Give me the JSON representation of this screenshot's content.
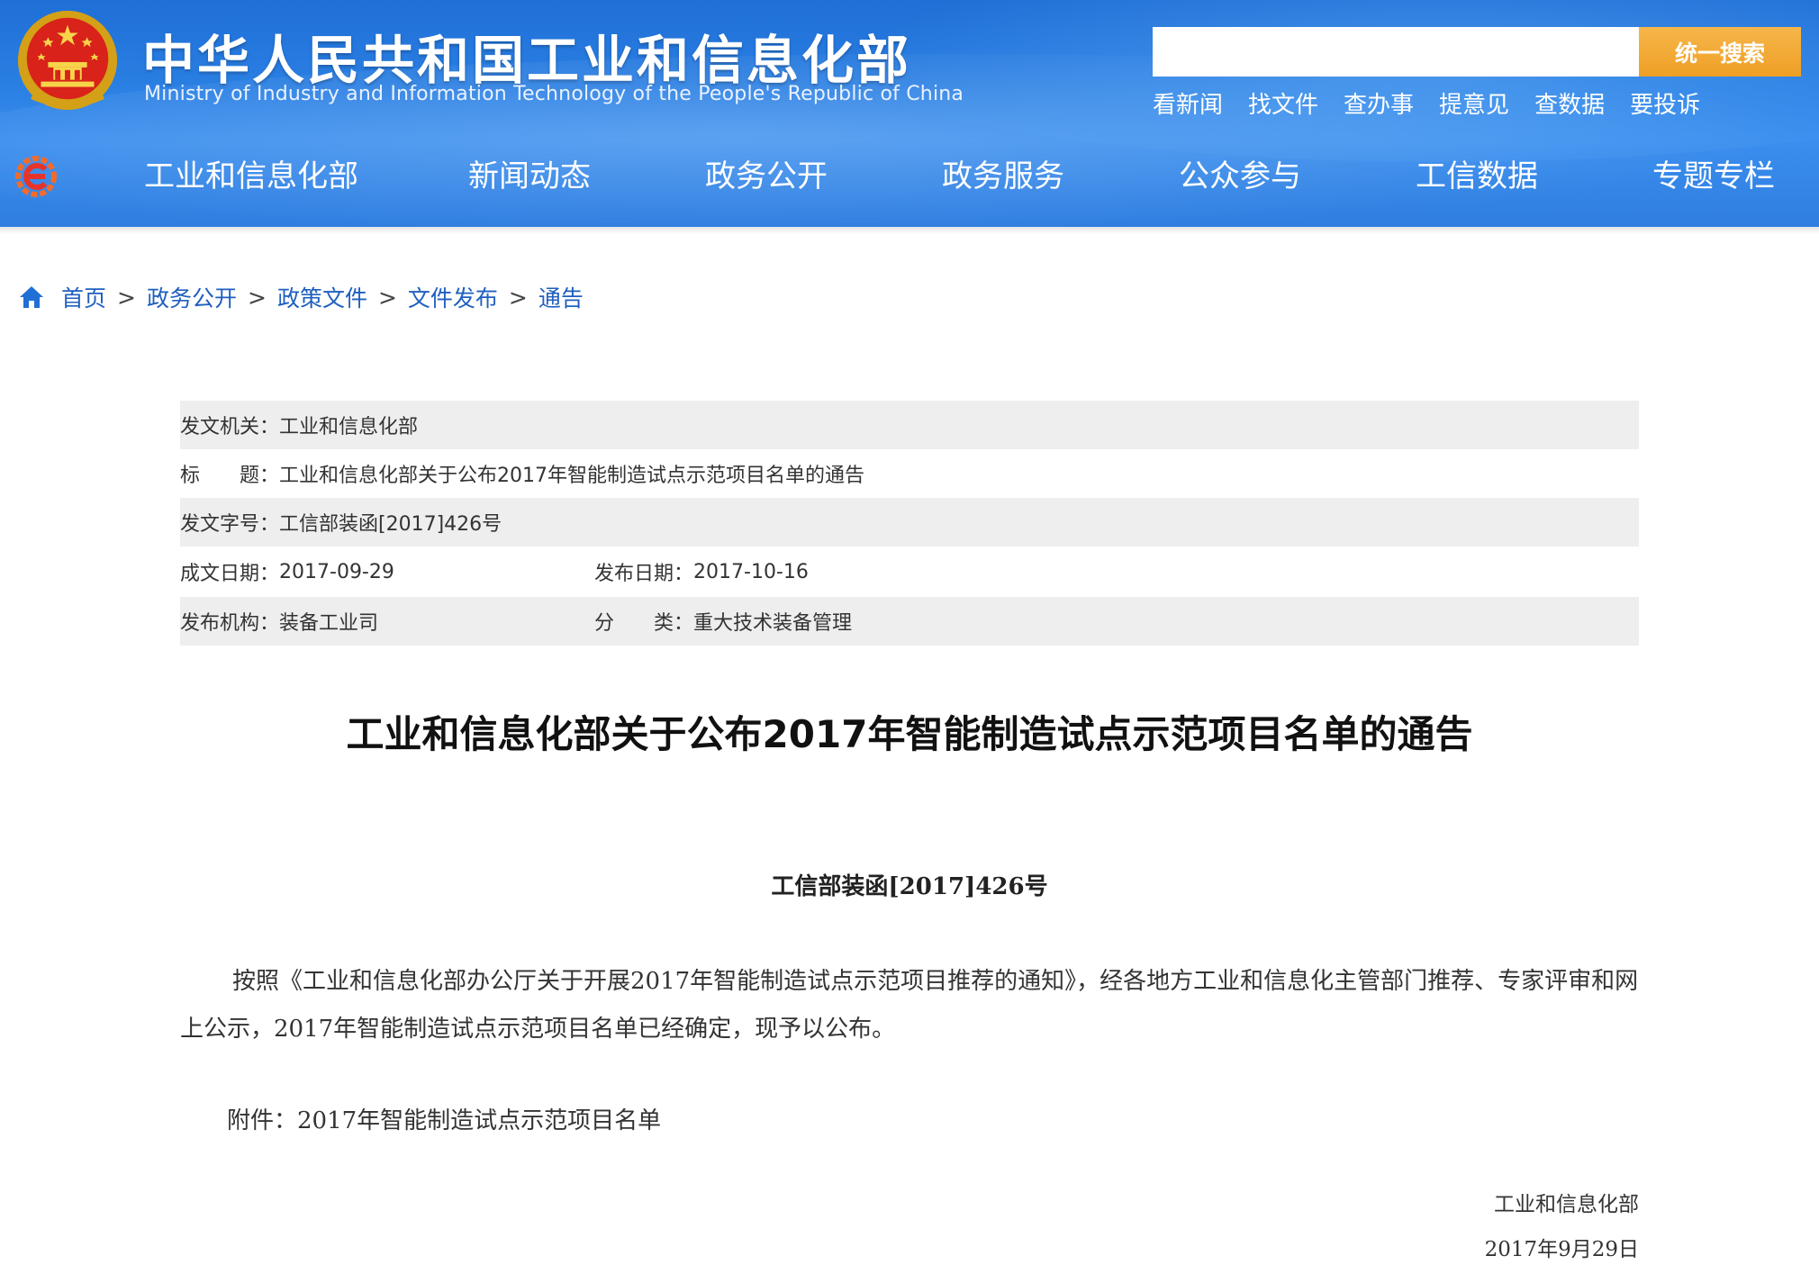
{
  "header": {
    "title_cn": "中华人民共和国工业和信息化部",
    "title_en": "Ministry of Industry and Information Technology of the People's Republic of China",
    "search": {
      "placeholder": "",
      "button_label": "统一搜索"
    },
    "quick_links": [
      "看新闻",
      "找文件",
      "查办事",
      "提意见",
      "查数据",
      "要投诉"
    ],
    "nav": [
      "工业和信息化部",
      "新闻动态",
      "政务公开",
      "政务服务",
      "公众参与",
      "工信数据",
      "专题专栏"
    ],
    "colors": {
      "header_blue": "#2a7fe3",
      "search_orange": "#f0a22e"
    }
  },
  "breadcrumb": [
    "首页",
    "政务公开",
    "政策文件",
    "文件发布",
    "通告"
  ],
  "breadcrumb_separator": ">",
  "info": {
    "issuer_label": "发文机关：",
    "issuer": "工业和信息化部",
    "title_label": "标　　题：",
    "title": "工业和信息化部关于公布2017年智能制造试点示范项目名单的通告",
    "doc_no_label": "发文字号：",
    "doc_no": "工信部装函[2017]426号",
    "written_date_label": "成文日期：",
    "written_date": "2017-09-29",
    "publish_date_label": "发布日期：",
    "publish_date": "2017-10-16",
    "org_label": "发布机构：",
    "org": "装备工业司",
    "category_label": "分　　类：",
    "category": "重大技术装备管理"
  },
  "document": {
    "title": "工业和信息化部关于公布2017年智能制造试点示范项目名单的通告",
    "number": "工信部装函[2017]426号",
    "body": "按照《工业和信息化部办公厅关于开展2017年智能制造试点示范项目推荐的通知》，经各地方工业和信息化主管部门推荐、专家评审和网上公示，2017年智能制造试点示范项目名单已经确定，现予以公布。",
    "attachment": "附件：2017年智能制造试点示范项目名单",
    "signature": "工业和信息化部",
    "date": "2017年9月29日"
  }
}
